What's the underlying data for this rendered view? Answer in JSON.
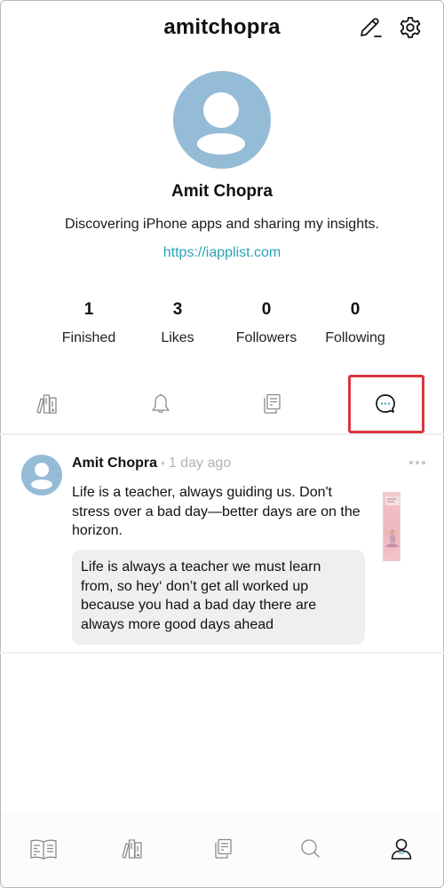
{
  "header": {
    "username": "amitchopra",
    "edit_icon": "pencil-icon",
    "settings_icon": "gear-icon"
  },
  "profile": {
    "avatar_icon": "user-avatar-icon",
    "display_name": "Amit Chopra",
    "bio": "Discovering iPhone apps and sharing my insights.",
    "website": "https://iapplist.com"
  },
  "stats": [
    {
      "value": "1",
      "label": "Finished"
    },
    {
      "value": "3",
      "label": "Likes"
    },
    {
      "value": "0",
      "label": "Followers"
    },
    {
      "value": "0",
      "label": "Following"
    }
  ],
  "tabs": [
    {
      "icon": "bookshelf-icon",
      "active": false
    },
    {
      "icon": "bell-icon",
      "active": false
    },
    {
      "icon": "documents-icon",
      "active": false
    },
    {
      "icon": "comment-icon",
      "active": true
    }
  ],
  "highlight_color": "#d9363e",
  "posts": [
    {
      "author": "Amit Chopra",
      "separator": "•",
      "time": "1 day ago",
      "text": "Life is a teacher, always guiding us. Don't stress over a bad day—better days are on the horizon.",
      "quote": "Life is always a teacher we must learn from, so hey‘ don’t get all worked up because you had a bad day there are always more good days ahead",
      "book_cover": "book-cover-meditation"
    }
  ],
  "bottom_nav": [
    {
      "icon": "open-book-icon",
      "active": false
    },
    {
      "icon": "bookshelf-icon",
      "active": false
    },
    {
      "icon": "documents-icon",
      "active": false
    },
    {
      "icon": "search-icon",
      "active": false
    },
    {
      "icon": "profile-icon",
      "active": true
    }
  ],
  "colors": {
    "avatar": "#94bcd7",
    "link": "#2aa3b8",
    "accent_dots": "#2aa3b8"
  }
}
